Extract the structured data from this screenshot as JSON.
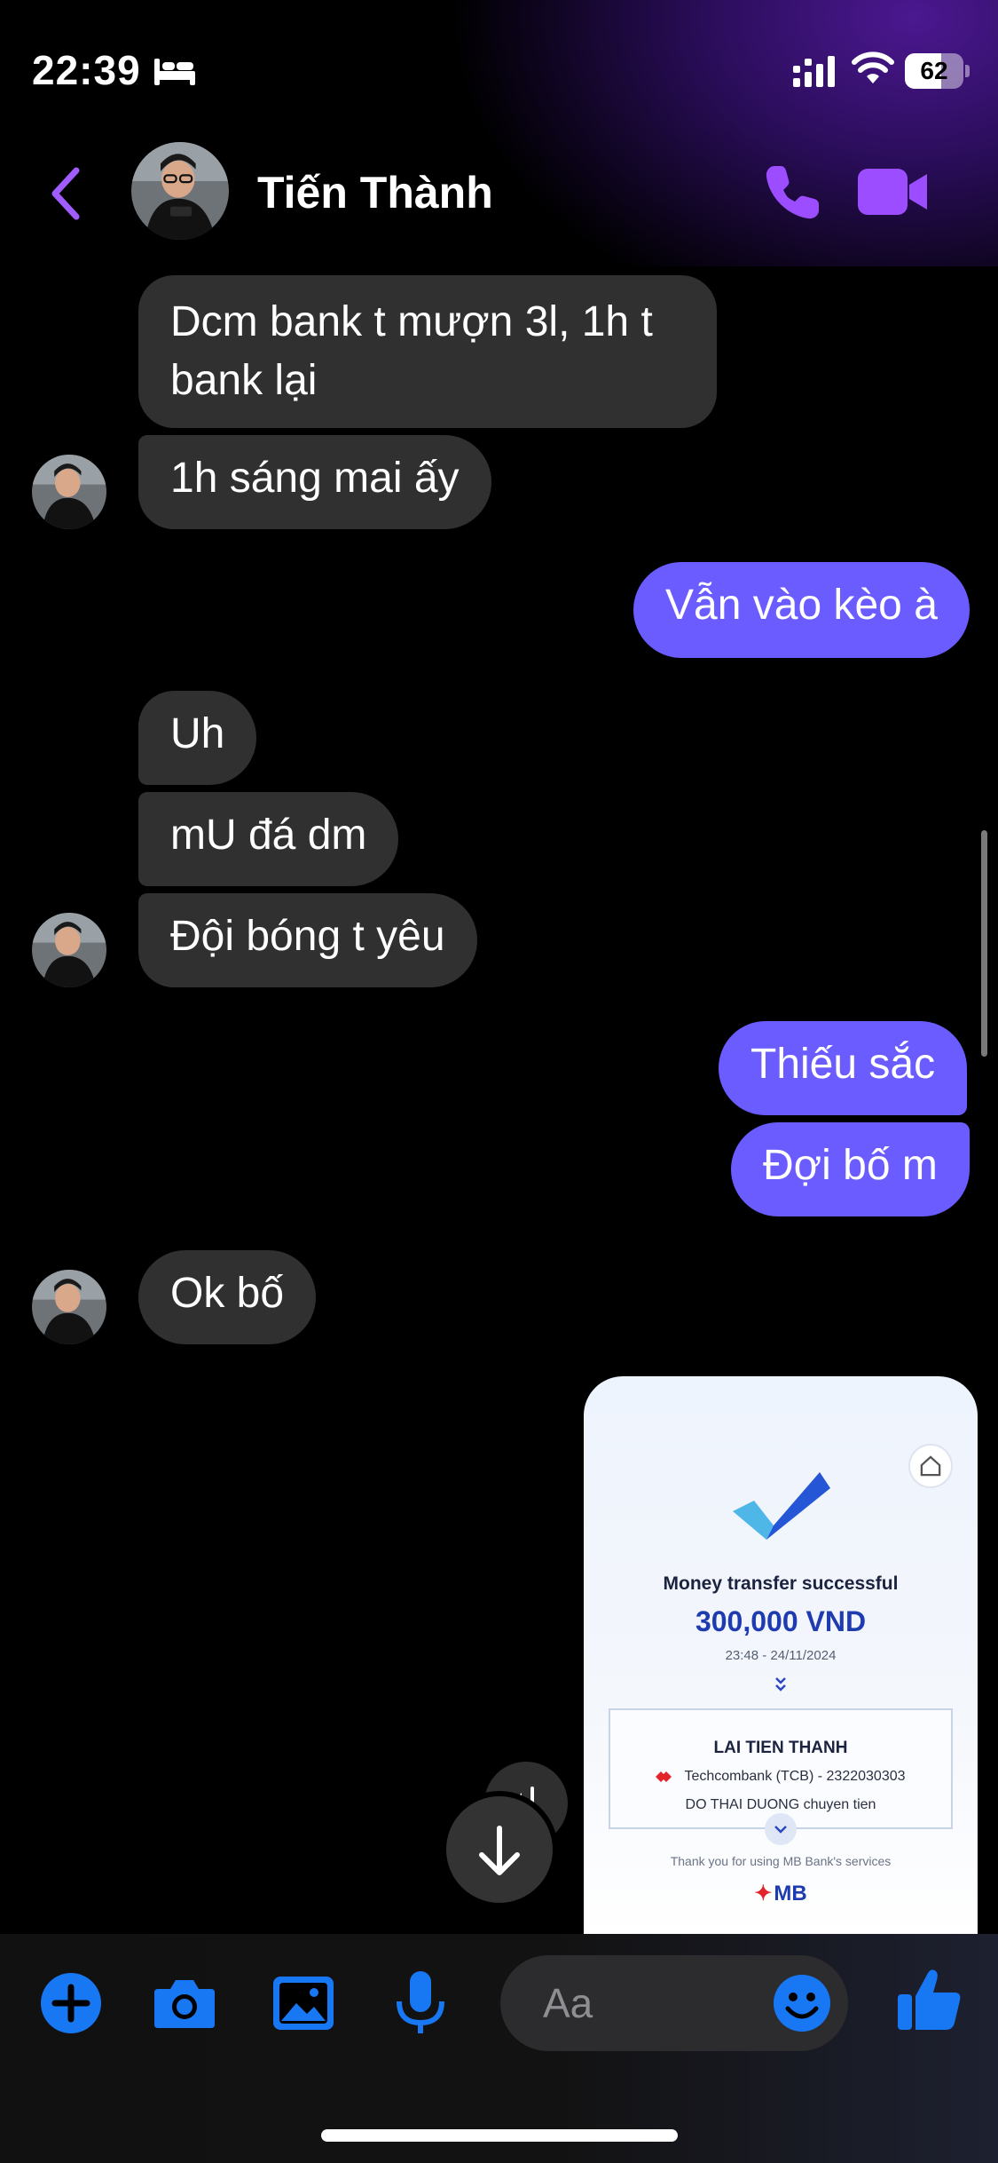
{
  "status_bar": {
    "time": "22:39",
    "battery": "62",
    "battery_level": 0.62
  },
  "header": {
    "contact_name": "Tiến Thành"
  },
  "messages": [
    {
      "text_line1": "Dcm bank t mượn 3l, 1h t",
      "text_line2": "bank lại"
    },
    {
      "text": "1h sáng mai ấy"
    },
    {
      "text": "Vẫn vào kèo à"
    },
    {
      "text": "Uh"
    },
    {
      "text": "mU đá dm"
    },
    {
      "text": "Đội bóng t yêu"
    },
    {
      "text": "Thiếu sắc"
    },
    {
      "text": "Đợi bố m"
    },
    {
      "text": "Ok bố"
    }
  ],
  "transfer_screenshot": {
    "title": "Money transfer successful",
    "amount": "300,000 VND",
    "datetime": "23:48 - 24/11/2024",
    "recipient": "LAI TIEN THANH",
    "bank": "Techcombank (TCB) - 2322030303",
    "note": "DO THAI DUONG chuyen tien",
    "thanks": "Thank you for using MB Bank's services",
    "logo": "MB"
  },
  "composer": {
    "placeholder": "Aa"
  },
  "colors": {
    "outgoing": "#6a5cff",
    "incoming": "#303030",
    "accent": "#9b5cf6",
    "action_blue": "#1877f2"
  },
  "icons": [
    "bed-icon",
    "signal-icon",
    "wifi-icon",
    "back-icon",
    "call-icon",
    "video-icon",
    "plus-icon",
    "camera-icon",
    "gallery-icon",
    "mic-icon",
    "emoji-icon",
    "like-icon",
    "arrow-down-icon",
    "share-icon"
  ]
}
